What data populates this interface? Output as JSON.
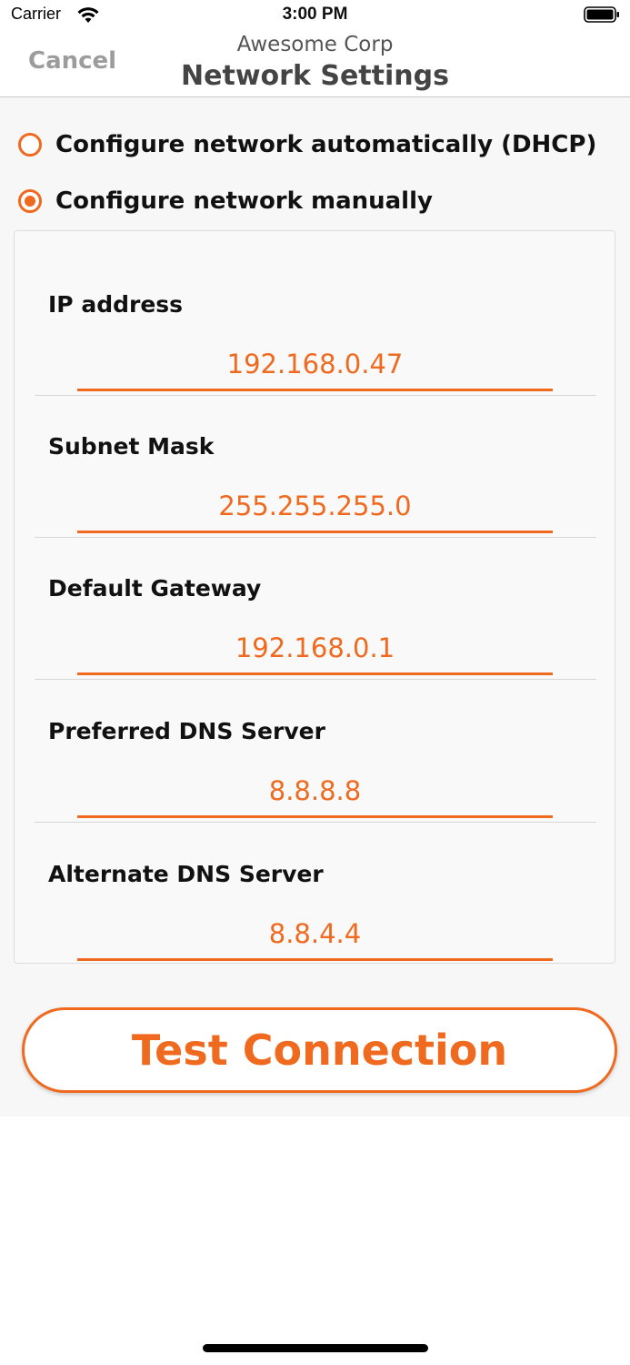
{
  "status_bar": {
    "carrier": "Carrier",
    "time": "3:00 PM",
    "icons": [
      "wifi-icon",
      "battery-icon"
    ]
  },
  "nav": {
    "cancel_label": "Cancel",
    "subtitle": "Awesome Corp",
    "title": "Network Settings"
  },
  "network_mode": {
    "options": [
      {
        "label": "Configure network automatically (DHCP)",
        "selected": false
      },
      {
        "label": "Configure network manually",
        "selected": true
      }
    ]
  },
  "fields": [
    {
      "label": "IP address",
      "value": "192.168.0.47"
    },
    {
      "label": "Subnet Mask",
      "value": "255.255.255.0"
    },
    {
      "label": "Default Gateway",
      "value": "192.168.0.1"
    },
    {
      "label": "Preferred DNS Server",
      "value": "8.8.8.8"
    },
    {
      "label": "Alternate DNS Server",
      "value": "8.8.4.4"
    }
  ],
  "actions": {
    "test_connection_label": "Test Connection"
  },
  "colors": {
    "accent": "#ef6a1f",
    "cancel_gray": "#9c9c9c",
    "title_gray": "#444444"
  }
}
